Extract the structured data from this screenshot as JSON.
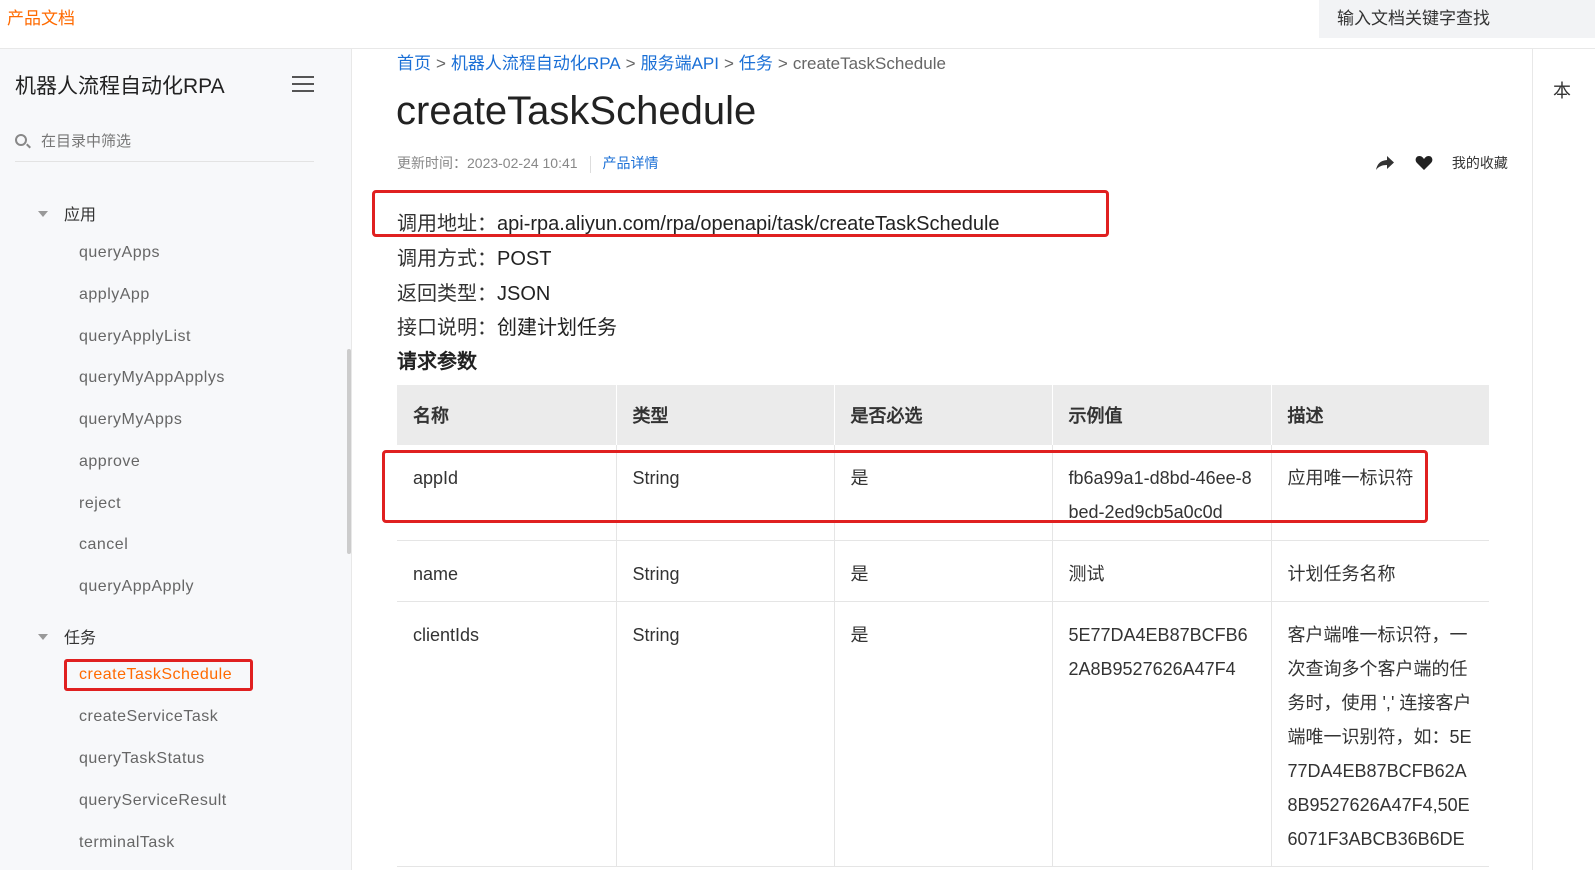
{
  "header": {
    "brand": "产品文档",
    "search_placeholder": "输入文档关键字查找"
  },
  "sidebar": {
    "title": "机器人流程自动化RPA",
    "filter_placeholder": "在目录中筛选",
    "groups": [
      {
        "label": "应用",
        "items": [
          "queryApps",
          "applyApp",
          "queryApplyList",
          "queryMyAppApplys",
          "queryMyApps",
          "approve",
          "reject",
          "cancel",
          "queryAppApply"
        ]
      },
      {
        "label": "任务",
        "items": [
          "createTaskSchedule",
          "createServiceTask",
          "queryTaskStatus",
          "queryServiceResult",
          "terminalTask"
        ]
      }
    ]
  },
  "breadcrumb": {
    "items": [
      "首页",
      "机器人流程自动化RPA",
      "服务端API",
      "任务",
      "createTaskSchedule"
    ],
    "separator": ">"
  },
  "page": {
    "title": "createTaskSchedule",
    "updated": "更新时间：2023-02-24 10:41",
    "product_link": "产品详情",
    "favorite_label": "我的收藏"
  },
  "api_info": {
    "address_label": "调用地址：",
    "address_value": "api-rpa.aliyun.com/rpa/openapi/task/createTaskSchedule",
    "method_label": "调用方式：",
    "method_value": "POST",
    "return_label": "返回类型：",
    "return_value": "JSON",
    "desc_label": "接口说明：",
    "desc_value": "创建计划任务"
  },
  "params": {
    "heading": "请求参数",
    "columns": [
      "名称",
      "类型",
      "是否必选",
      "示例值",
      "描述"
    ],
    "rows": [
      {
        "name": "appId",
        "type": "String",
        "required": "是",
        "example": "fb6a99a1-d8bd-46ee-8bed-2ed9cb5a0c0d",
        "desc": "应用唯一标识符"
      },
      {
        "name": "name",
        "type": "String",
        "required": "是",
        "example": "测试",
        "desc": "计划任务名称"
      },
      {
        "name": "clientIds",
        "type": "String",
        "required": "是",
        "example": "5E77DA4EB87BCFB62A8B9527626A47F4",
        "desc": "客户端唯一标识符，一次查询多个客户端的任务时，使用 ',' 连接客户端唯一识别符，如：5E77DA4EB87BCFB62A8B9527626A47F4,50E6071F3ABCB36B6DE"
      }
    ]
  },
  "right_rail": {
    "label": "本"
  },
  "colors": {
    "brand": "#ff6a00",
    "link": "#1a6fd6",
    "highlight": "#e02020"
  }
}
